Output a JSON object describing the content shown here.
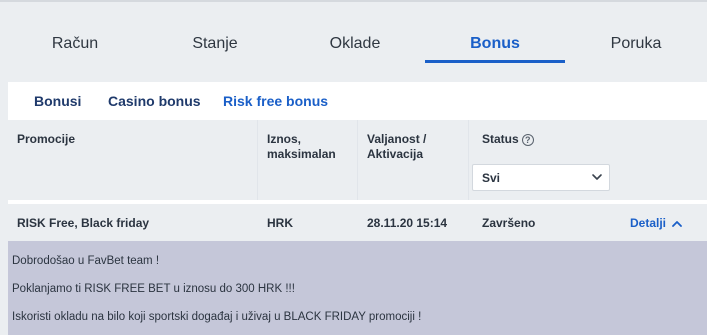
{
  "main_tabs": [
    {
      "label": "Račun"
    },
    {
      "label": "Stanje"
    },
    {
      "label": "Oklade"
    },
    {
      "label": "Bonus",
      "active": true
    },
    {
      "label": "Poruka"
    }
  ],
  "sub_tabs": [
    {
      "label": "Bonusi"
    },
    {
      "label": "Casino bonus"
    },
    {
      "label": "Risk free bonus",
      "active": true
    }
  ],
  "table": {
    "headers": {
      "promo": "Promocije",
      "amount_line1": "Iznos,",
      "amount_line2": "maksimalan",
      "validity_line1": "Valjanost /",
      "validity_line2": "Aktivacija",
      "status": "Status"
    },
    "status_filter": {
      "selected": "Svi"
    },
    "rows": [
      {
        "promo": "RISK Free, Black friday",
        "amount": "HRK",
        "validity": "28.11.20 15:14",
        "status": "Završeno",
        "details_label": "Detalji"
      }
    ],
    "details_text": [
      "Dobrodošao u FavBet team !",
      "Poklanjamo ti RISK FREE BET u iznosu do 300 HRK !!!",
      "Iskoristi okladu na bilo koji sportski događaj i uživaj u BLACK FRIDAY promociji !"
    ]
  },
  "colors": {
    "accent": "#1a5fc8",
    "details_bg": "#c5c7d9",
    "page_bg": "#ebeef1"
  }
}
